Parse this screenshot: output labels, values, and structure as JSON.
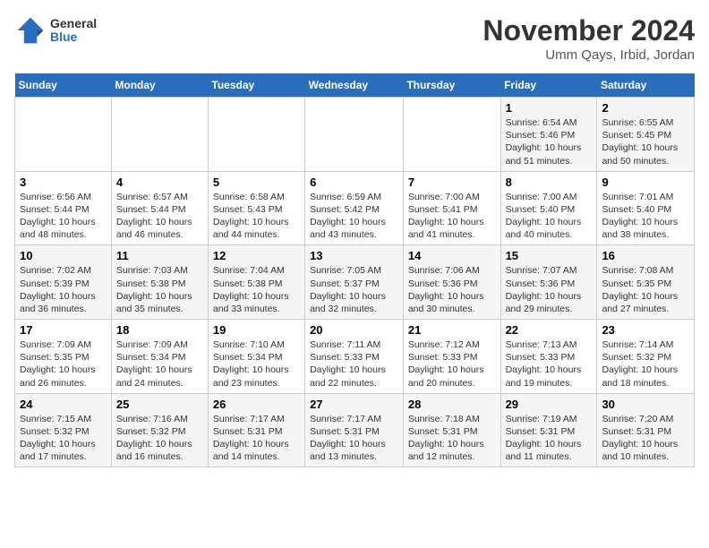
{
  "header": {
    "logo_general": "General",
    "logo_blue": "Blue",
    "month": "November 2024",
    "location": "Umm Qays, Irbid, Jordan"
  },
  "weekdays": [
    "Sunday",
    "Monday",
    "Tuesday",
    "Wednesday",
    "Thursday",
    "Friday",
    "Saturday"
  ],
  "weeks": [
    [
      {
        "day": "",
        "info": ""
      },
      {
        "day": "",
        "info": ""
      },
      {
        "day": "",
        "info": ""
      },
      {
        "day": "",
        "info": ""
      },
      {
        "day": "",
        "info": ""
      },
      {
        "day": "1",
        "info": "Sunrise: 6:54 AM\nSunset: 5:46 PM\nDaylight: 10 hours and 51 minutes."
      },
      {
        "day": "2",
        "info": "Sunrise: 6:55 AM\nSunset: 5:45 PM\nDaylight: 10 hours and 50 minutes."
      }
    ],
    [
      {
        "day": "3",
        "info": "Sunrise: 6:56 AM\nSunset: 5:44 PM\nDaylight: 10 hours and 48 minutes."
      },
      {
        "day": "4",
        "info": "Sunrise: 6:57 AM\nSunset: 5:44 PM\nDaylight: 10 hours and 46 minutes."
      },
      {
        "day": "5",
        "info": "Sunrise: 6:58 AM\nSunset: 5:43 PM\nDaylight: 10 hours and 44 minutes."
      },
      {
        "day": "6",
        "info": "Sunrise: 6:59 AM\nSunset: 5:42 PM\nDaylight: 10 hours and 43 minutes."
      },
      {
        "day": "7",
        "info": "Sunrise: 7:00 AM\nSunset: 5:41 PM\nDaylight: 10 hours and 41 minutes."
      },
      {
        "day": "8",
        "info": "Sunrise: 7:00 AM\nSunset: 5:40 PM\nDaylight: 10 hours and 40 minutes."
      },
      {
        "day": "9",
        "info": "Sunrise: 7:01 AM\nSunset: 5:40 PM\nDaylight: 10 hours and 38 minutes."
      }
    ],
    [
      {
        "day": "10",
        "info": "Sunrise: 7:02 AM\nSunset: 5:39 PM\nDaylight: 10 hours and 36 minutes."
      },
      {
        "day": "11",
        "info": "Sunrise: 7:03 AM\nSunset: 5:38 PM\nDaylight: 10 hours and 35 minutes."
      },
      {
        "day": "12",
        "info": "Sunrise: 7:04 AM\nSunset: 5:38 PM\nDaylight: 10 hours and 33 minutes."
      },
      {
        "day": "13",
        "info": "Sunrise: 7:05 AM\nSunset: 5:37 PM\nDaylight: 10 hours and 32 minutes."
      },
      {
        "day": "14",
        "info": "Sunrise: 7:06 AM\nSunset: 5:36 PM\nDaylight: 10 hours and 30 minutes."
      },
      {
        "day": "15",
        "info": "Sunrise: 7:07 AM\nSunset: 5:36 PM\nDaylight: 10 hours and 29 minutes."
      },
      {
        "day": "16",
        "info": "Sunrise: 7:08 AM\nSunset: 5:35 PM\nDaylight: 10 hours and 27 minutes."
      }
    ],
    [
      {
        "day": "17",
        "info": "Sunrise: 7:09 AM\nSunset: 5:35 PM\nDaylight: 10 hours and 26 minutes."
      },
      {
        "day": "18",
        "info": "Sunrise: 7:09 AM\nSunset: 5:34 PM\nDaylight: 10 hours and 24 minutes."
      },
      {
        "day": "19",
        "info": "Sunrise: 7:10 AM\nSunset: 5:34 PM\nDaylight: 10 hours and 23 minutes."
      },
      {
        "day": "20",
        "info": "Sunrise: 7:11 AM\nSunset: 5:33 PM\nDaylight: 10 hours and 22 minutes."
      },
      {
        "day": "21",
        "info": "Sunrise: 7:12 AM\nSunset: 5:33 PM\nDaylight: 10 hours and 20 minutes."
      },
      {
        "day": "22",
        "info": "Sunrise: 7:13 AM\nSunset: 5:33 PM\nDaylight: 10 hours and 19 minutes."
      },
      {
        "day": "23",
        "info": "Sunrise: 7:14 AM\nSunset: 5:32 PM\nDaylight: 10 hours and 18 minutes."
      }
    ],
    [
      {
        "day": "24",
        "info": "Sunrise: 7:15 AM\nSunset: 5:32 PM\nDaylight: 10 hours and 17 minutes."
      },
      {
        "day": "25",
        "info": "Sunrise: 7:16 AM\nSunset: 5:32 PM\nDaylight: 10 hours and 16 minutes."
      },
      {
        "day": "26",
        "info": "Sunrise: 7:17 AM\nSunset: 5:31 PM\nDaylight: 10 hours and 14 minutes."
      },
      {
        "day": "27",
        "info": "Sunrise: 7:17 AM\nSunset: 5:31 PM\nDaylight: 10 hours and 13 minutes."
      },
      {
        "day": "28",
        "info": "Sunrise: 7:18 AM\nSunset: 5:31 PM\nDaylight: 10 hours and 12 minutes."
      },
      {
        "day": "29",
        "info": "Sunrise: 7:19 AM\nSunset: 5:31 PM\nDaylight: 10 hours and 11 minutes."
      },
      {
        "day": "30",
        "info": "Sunrise: 7:20 AM\nSunset: 5:31 PM\nDaylight: 10 hours and 10 minutes."
      }
    ]
  ]
}
